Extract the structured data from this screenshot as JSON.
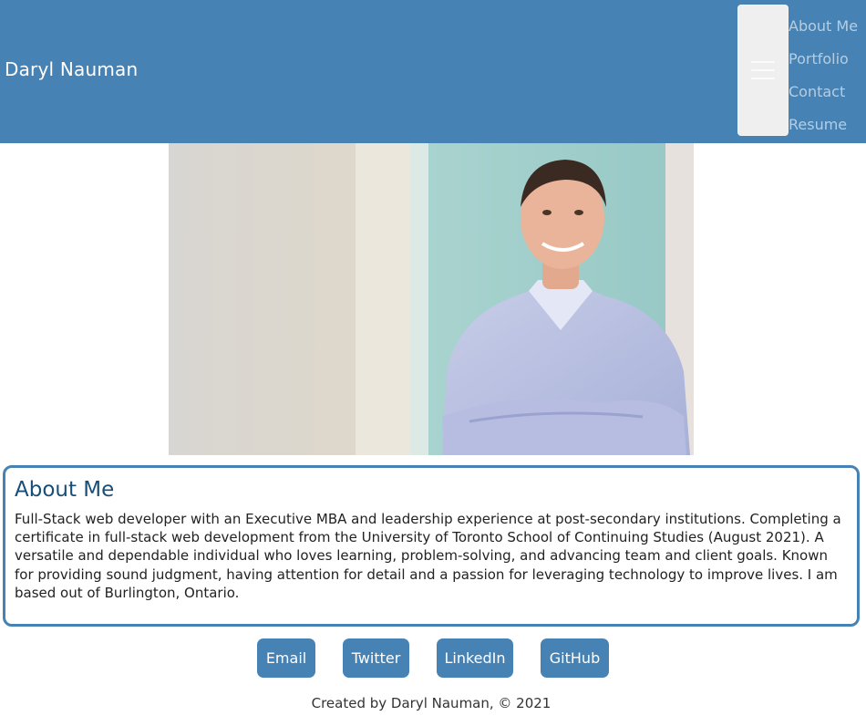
{
  "header": {
    "brand": "Daryl Nauman",
    "menu_icon": "hamburger-menu-icon",
    "nav": [
      "About Me",
      "Portfolio",
      "Contact",
      "Resume"
    ]
  },
  "photo": {
    "alt": "Daryl Nauman portrait"
  },
  "about": {
    "heading": "About Me",
    "body": "Full-Stack web developer with an Executive MBA and leadership experience at post-secondary institutions. Completing a certificate in full-stack web development from the University of Toronto School of Continuing Studies (August 2021). A versatile and dependable individual who loves learning, problem-solving, and advancing team and client goals. Known for providing sound judgment, having attention for detail and a passion for leveraging technology to improve lives. I am based out of Burlington, Ontario."
  },
  "social": {
    "email": "Email",
    "twitter": "Twitter",
    "linkedin": "LinkedIn",
    "github": "GitHub"
  },
  "footer": {
    "text": "Created by Daryl Nauman, © 2021"
  },
  "colors": {
    "accent": "#4682b4",
    "heading": "#184e77"
  }
}
